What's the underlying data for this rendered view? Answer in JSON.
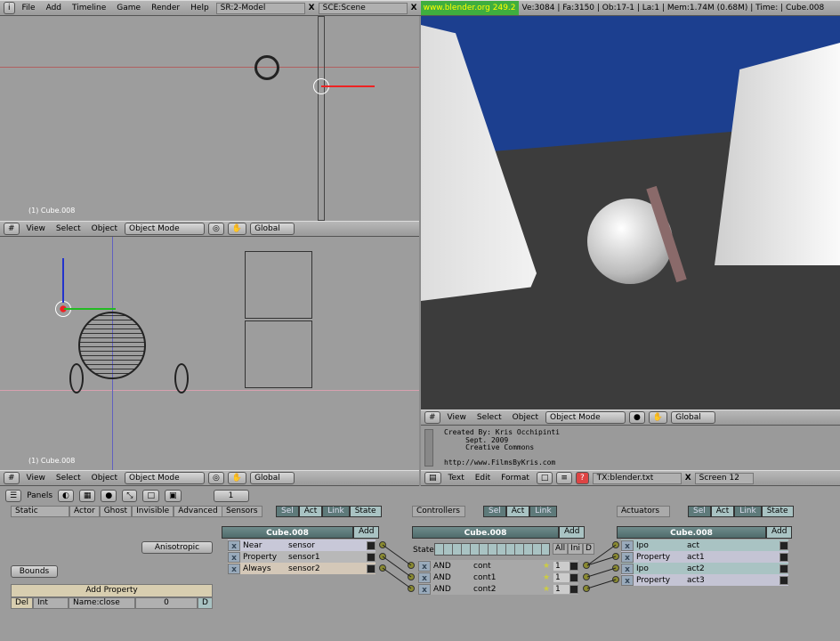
{
  "topbar": {
    "menus": [
      "File",
      "Add",
      "Timeline",
      "Game",
      "Render",
      "Help"
    ],
    "screen": "SR:2-Model",
    "scene": "SCE:Scene",
    "site": "www.blender.org 249.2",
    "stats": "Ve:3084 | Fa:3150 | Ob:17-1 | La:1  | Mem:1.74M (0.68M)  | Time: | Cube.008"
  },
  "viewports": {
    "top_label": "(1) Cube.008",
    "bottom_label": "(1) Cube.008",
    "menus": [
      "View",
      "Select",
      "Object"
    ],
    "mode": "Object Mode",
    "orientation": "Global"
  },
  "text_editor": {
    "lines": [
      "Created By: Kris Occhipinti",
      "     Sept. 2009",
      "     Creative Commons",
      "",
      "http://www.FilmsByKris.com"
    ],
    "menus": [
      "Text",
      "Edit",
      "Format"
    ],
    "file": "TX:blender.txt",
    "screen": "Screen 12"
  },
  "buttons": {
    "panels": "Panels",
    "frame": "1",
    "type": "Static",
    "toggles": [
      "Actor",
      "Ghost",
      "Invisible",
      "Advanced"
    ],
    "anisotropic": "Anisotropic",
    "bounds": "Bounds",
    "add_property": "Add Property",
    "prop": {
      "del": "Del",
      "type": "Int",
      "name": "Name:close",
      "value": "0",
      "d": "D"
    }
  },
  "logic": {
    "sensors": {
      "label": "Sensors",
      "filters": [
        "Sel",
        "Act",
        "Link",
        "State"
      ],
      "object": "Cube.008",
      "add": "Add",
      "items": [
        {
          "type": "Near",
          "name": "sensor"
        },
        {
          "type": "Property",
          "name": "sensor1"
        },
        {
          "type": "Always",
          "name": "sensor2"
        }
      ]
    },
    "controllers": {
      "label": "Controllers",
      "filters": [
        "Sel",
        "Act",
        "Link"
      ],
      "object": "Cube.008",
      "add": "Add",
      "state": "State",
      "state_btns": [
        "All",
        "Ini",
        "D"
      ],
      "items": [
        {
          "type": "AND",
          "name": "cont",
          "n": "1"
        },
        {
          "type": "AND",
          "name": "cont1",
          "n": "1"
        },
        {
          "type": "AND",
          "name": "cont2",
          "n": "1"
        }
      ]
    },
    "actuators": {
      "label": "Actuators",
      "filters": [
        "Sel",
        "Act",
        "Link",
        "State"
      ],
      "object": "Cube.008",
      "add": "Add",
      "items": [
        {
          "type": "Ipo",
          "name": "act"
        },
        {
          "type": "Property",
          "name": "act1"
        },
        {
          "type": "Ipo",
          "name": "act2"
        },
        {
          "type": "Property",
          "name": "act3"
        }
      ]
    }
  },
  "colors": {
    "sky": "#1c3f8f",
    "floor": "#3c3c3c",
    "site_bg": "#3fae3f"
  }
}
